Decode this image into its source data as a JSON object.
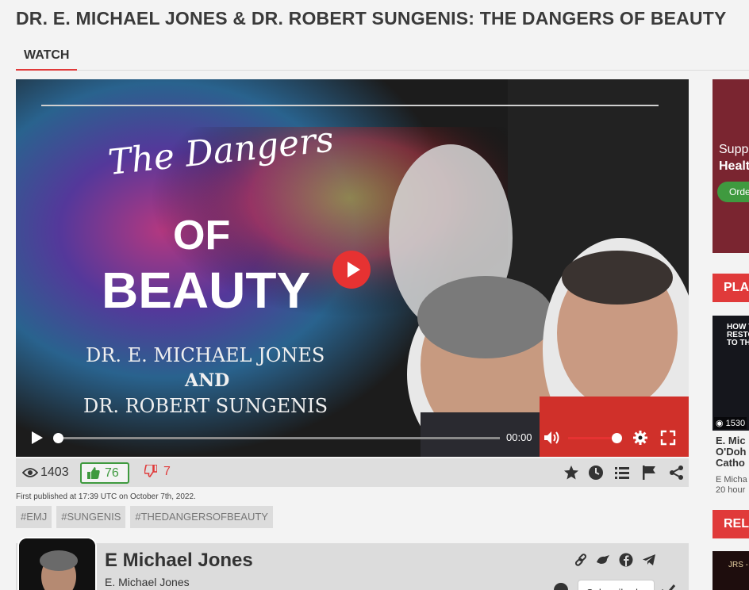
{
  "page": {
    "title": "DR. E. MICHAEL JONES & DR. ROBERT SUNGENIS: THE DANGERS OF BEAUTY",
    "tab": "WATCH"
  },
  "video": {
    "art_title_script": "The Dangers",
    "art_title_of": "OF",
    "art_title_beauty": "BEAUTY",
    "art_line1": "DR. E. MICHAEL JONES",
    "art_line2": "AND",
    "art_line3": "DR. ROBERT SUNGENIS",
    "time": "00:00",
    "progress": 0.0,
    "volume": 1.0
  },
  "stats": {
    "views": "1403",
    "likes": "76",
    "dislikes": "7"
  },
  "published": "First published at 17:39 UTC on October 7th, 2022.",
  "tags": [
    "#EMJ",
    "#SUNGENIS",
    "#THEDANGERSOFBEAUTY"
  ],
  "channel": {
    "name": "E Michael Jones",
    "handle": "E. Michael Jones",
    "subscribe": "Subscribed"
  },
  "sidebar": {
    "ad_line1": "Supp",
    "ad_line2": "Healt",
    "ad_button": "Orde",
    "playlists_head": "PLA",
    "thumb_text_1": "HOW T",
    "thumb_text_2": "RESTOR",
    "thumb_text_3": "TO THE",
    "thumb_views": "1530",
    "item_title_1": "E. Mic",
    "item_title_2": "O'Doh",
    "item_title_3": "Catho",
    "item_author": "E Micha",
    "item_age": "20 hour",
    "related_head": "REL",
    "thumb2_text": "JRS -"
  },
  "colors": {
    "accent": "#e03a3a",
    "like_green": "#3f9a3f",
    "ad_bg": "#7a2530"
  }
}
